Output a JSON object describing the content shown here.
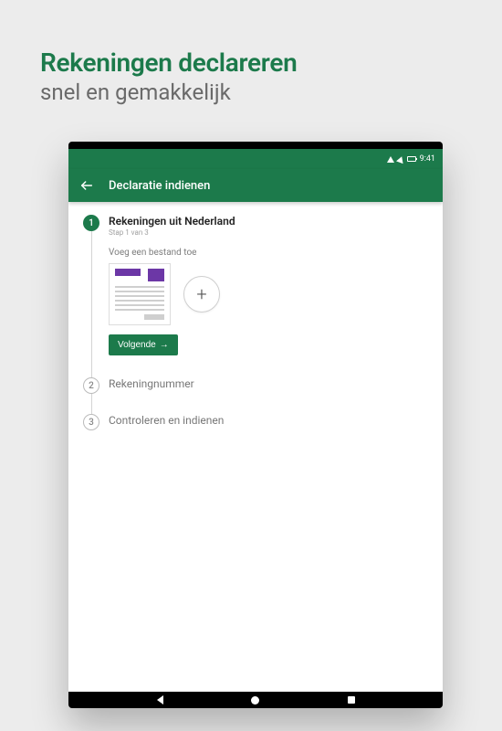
{
  "promo": {
    "title": "Rekeningen declareren",
    "subtitle": "snel en gemakkelijk"
  },
  "status": {
    "time": "9:41"
  },
  "appbar": {
    "title": "Declaratie indienen"
  },
  "steps": {
    "s1": {
      "num": "1",
      "title": "Rekeningen uit Nederland",
      "sub": "Stap 1 van 3",
      "attach_label": "Voeg een bestand toe",
      "next_label": "Volgende"
    },
    "s2": {
      "num": "2",
      "title": "Rekeningnummer"
    },
    "s3": {
      "num": "3",
      "title": "Controleren en indienen"
    }
  },
  "icons": {
    "back": "arrow-left",
    "add": "+",
    "next_arrow": "→"
  },
  "colors": {
    "accent": "#1c7a4b"
  }
}
